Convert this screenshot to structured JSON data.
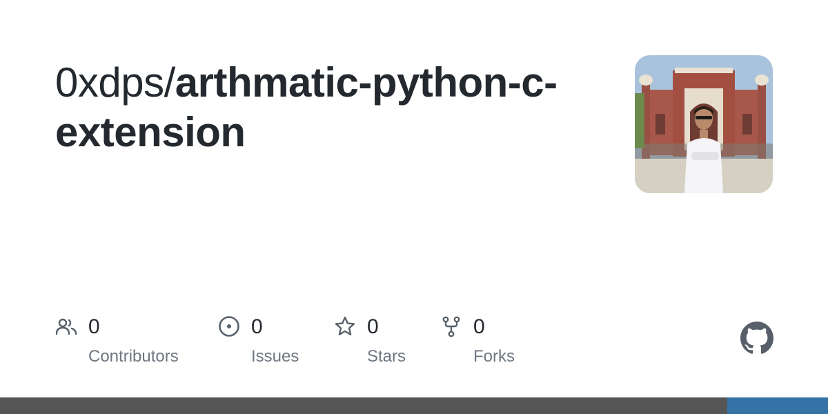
{
  "repo": {
    "owner": "0xdps/",
    "name": "arthmatic-python-c-extension"
  },
  "avatar": {
    "alt": "0xdps"
  },
  "stats": [
    {
      "icon": "people-icon",
      "count": "0",
      "label": "Contributors"
    },
    {
      "icon": "issue-icon",
      "count": "0",
      "label": "Issues"
    },
    {
      "icon": "star-icon",
      "count": "0",
      "label": "Stars"
    },
    {
      "icon": "fork-icon",
      "count": "0",
      "label": "Forks"
    }
  ],
  "colors": {
    "text": "#24292f",
    "muted": "#6e7781",
    "icon": "#57606a",
    "bar_primary": "#555555",
    "bar_secondary": "#3572a5"
  },
  "languages": [
    {
      "color": "#555555",
      "share": 0.878
    },
    {
      "color": "#3572a5",
      "share": 0.122
    }
  ]
}
